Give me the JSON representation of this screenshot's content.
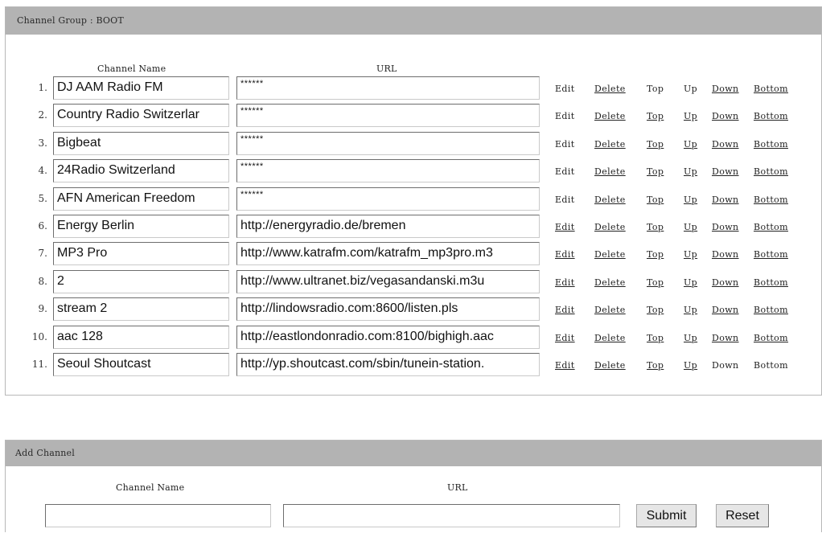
{
  "group": {
    "title": "Channel Group : BOOT",
    "col_name": "Channel Name",
    "col_url": "URL",
    "actions": {
      "edit": "Edit",
      "delete": "Delete",
      "top": "Top",
      "up": "Up",
      "down": "Down",
      "bottom": "Bottom"
    },
    "channels": [
      {
        "num": "1.",
        "name": "DJ AAM Radio FM",
        "url": "******"
      },
      {
        "num": "2.",
        "name": "Country Radio Switzerlar",
        "url": "******"
      },
      {
        "num": "3.",
        "name": "Bigbeat",
        "url": "******"
      },
      {
        "num": "4.",
        "name": "24Radio Switzerland",
        "url": "******"
      },
      {
        "num": "5.",
        "name": "AFN American Freedom",
        "url": "******"
      },
      {
        "num": "6.",
        "name": "Energy Berlin",
        "url": "http://energyradio.de/bremen"
      },
      {
        "num": "7.",
        "name": "MP3 Pro",
        "url": "http://www.katrafm.com/katrafm_mp3pro.m3"
      },
      {
        "num": "8.",
        "name": "2",
        "url": "http://www.ultranet.biz/vegasandanski.m3u"
      },
      {
        "num": "9.",
        "name": "stream 2",
        "url": "http://lindowsradio.com:8600/listen.pls"
      },
      {
        "num": "10.",
        "name": "aac 128",
        "url": "http://eastlondonradio.com:8100/bighigh.aac"
      },
      {
        "num": "11.",
        "name": "Seoul Shoutcast",
        "url": "http://yp.shoutcast.com/sbin/tunein-station."
      }
    ]
  },
  "add": {
    "title": "Add Channel",
    "col_name": "Channel Name",
    "col_url": "URL",
    "name_value": "",
    "url_value": "",
    "submit_label": "Submit",
    "reset_label": "Reset"
  }
}
